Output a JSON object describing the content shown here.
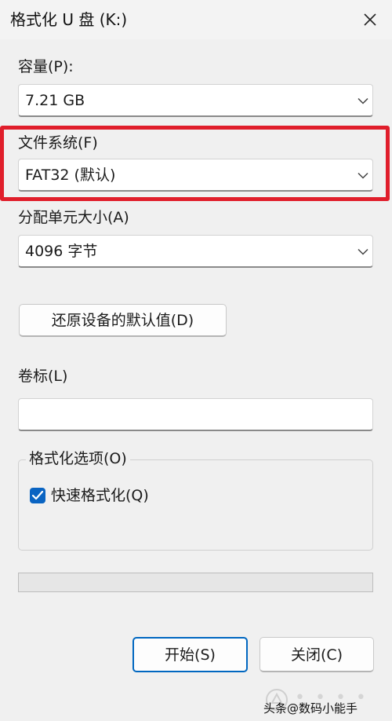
{
  "window": {
    "title": "格式化 U 盘 (K:)"
  },
  "capacity": {
    "label": "容量(P):",
    "value": "7.21 GB"
  },
  "file_system": {
    "label": "文件系统(F)",
    "value": "FAT32 (默认)"
  },
  "allocation": {
    "label": "分配单元大小(A)",
    "value": "4096 字节"
  },
  "restore_defaults_button": "还原设备的默认值(D)",
  "volume_label": {
    "label": "卷标(L)",
    "value": ""
  },
  "format_options": {
    "label": "格式化选项(O)",
    "quick_format_label": "快速格式化(Q)",
    "quick_format_checked": true
  },
  "progress": {
    "percent": 0
  },
  "buttons": {
    "start": "开始(S)",
    "close": "关闭(C)"
  },
  "colors": {
    "accent": "#0067c0",
    "highlight_box": "#e01e2b"
  },
  "watermark": {
    "text": "头条@数码小能手"
  }
}
